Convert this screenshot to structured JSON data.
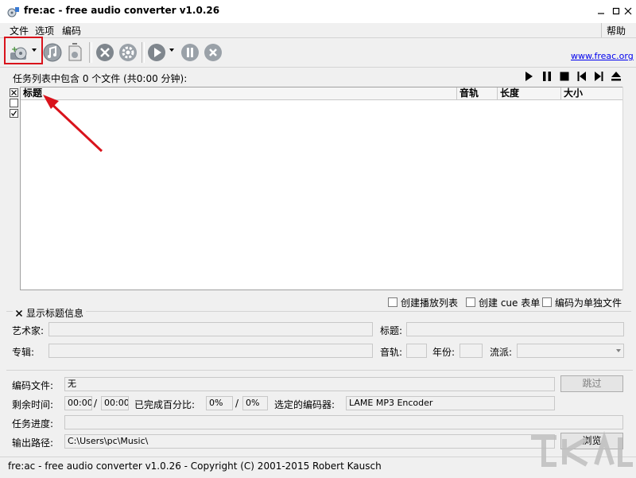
{
  "window": {
    "title": "fre:ac - free audio converter v1.0.26"
  },
  "menu": {
    "file": "文件",
    "options": "选项",
    "encode": "编码",
    "help": "帮助"
  },
  "toolbar": {
    "link": "www.freac.org"
  },
  "joblist": {
    "summary": "任务列表中包含 0 个文件 (共0:00 分钟):",
    "columns": {
      "title": "标题",
      "track": "音轨",
      "length": "长度",
      "size": "大小"
    }
  },
  "options": {
    "playlist": "创建播放列表",
    "cue": "创建 cue 表单",
    "single_file": "编码为单独文件"
  },
  "title_info": {
    "legend": "显示标题信息",
    "artist_label": "艺术家:",
    "title_label": "标题:",
    "album_label": "专辑:",
    "track_label": "音轨:",
    "year_label": "年份:",
    "genre_label": "流派:"
  },
  "encoding": {
    "file_label": "编码文件:",
    "file_value": "无",
    "skip_button": "跳过",
    "remaining_label": "剩余时间:",
    "remaining_value": "00:00",
    "total_value": "00:00",
    "slash1": "/",
    "percent_label": "已完成百分比:",
    "percent_value": "0%",
    "percent_total": "0%",
    "slash2": "/",
    "encoder_label": "选定的编码器:",
    "encoder_value": "LAME MP3 Encoder",
    "progress_label": "任务进度:",
    "output_label": "输出路径:",
    "output_value": "C:\\Users\\pc\\Music\\",
    "browse_button": "浏览"
  },
  "status": {
    "text": "fre:ac - free audio converter v1.0.26 - Copyright (C) 2001-2015 Robert Kausch"
  },
  "colors": {
    "highlight": "#d9131c",
    "link": "#0000ee",
    "desktop": "#1b5ea8"
  }
}
